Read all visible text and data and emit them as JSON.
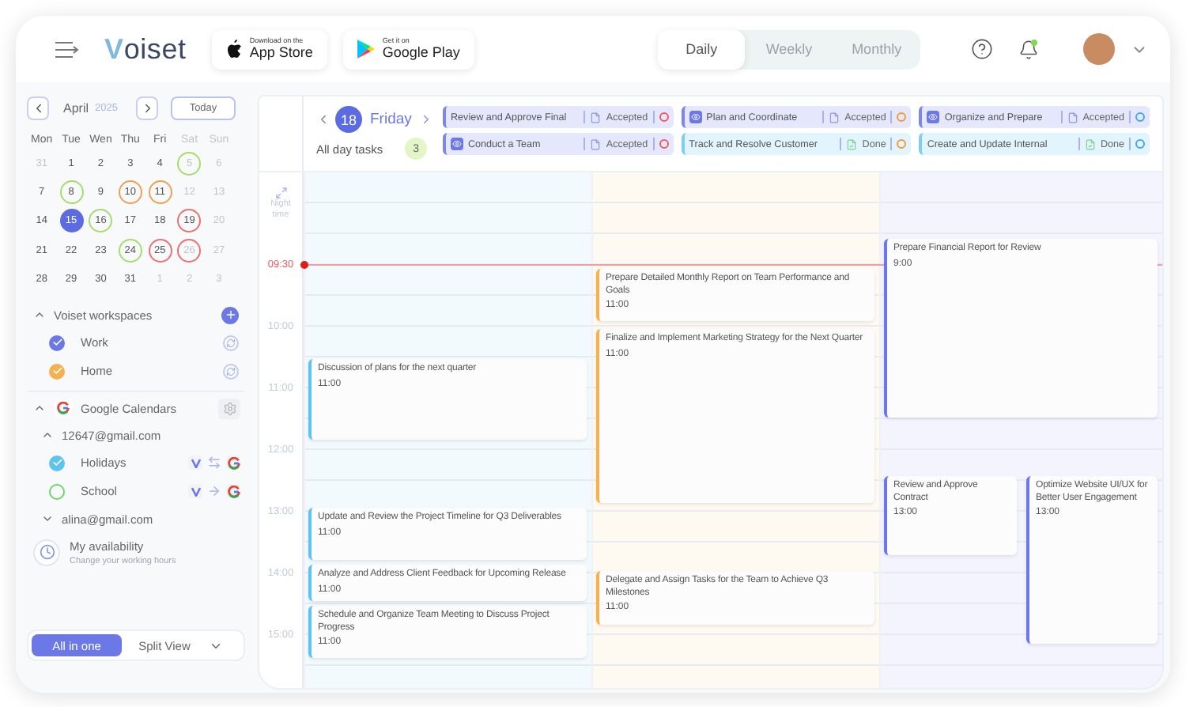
{
  "header": {
    "logo": "Voiset",
    "store_badges": [
      {
        "kind": "apple",
        "small": "Download on the",
        "big": "App Store"
      },
      {
        "kind": "google",
        "small": "Get it on",
        "big": "Google Play"
      }
    ],
    "views": [
      {
        "label": "Daily",
        "selected": true
      },
      {
        "label": "Weekly",
        "selected": false
      },
      {
        "label": "Monthly",
        "selected": false
      }
    ],
    "notifications_unread": true
  },
  "mini_calendar": {
    "month": "April",
    "year": "2025",
    "today": "Today",
    "weekdays": [
      {
        "label": "Mon",
        "weekend": false
      },
      {
        "label": "Tue",
        "weekend": false
      },
      {
        "label": "Wen",
        "weekend": false
      },
      {
        "label": "Thu",
        "weekend": false
      },
      {
        "label": "Fri",
        "weekend": false
      },
      {
        "label": "Sat",
        "weekend": true
      },
      {
        "label": "Sun",
        "weekend": true
      }
    ],
    "weeks": [
      [
        {
          "label": "31",
          "faded": true,
          "selected": false
        },
        {
          "label": "1",
          "faded": false,
          "selected": false
        },
        {
          "label": "2",
          "faded": false,
          "selected": false
        },
        {
          "label": "3",
          "faded": false,
          "selected": false
        },
        {
          "label": "4",
          "faded": false,
          "selected": false
        },
        {
          "label": "5",
          "faded": true,
          "selected": false,
          "color": "#a6dc6b"
        },
        {
          "label": "6",
          "faded": true,
          "selected": false
        }
      ],
      [
        {
          "label": "7",
          "faded": false,
          "selected": false
        },
        {
          "label": "8",
          "faded": false,
          "selected": false,
          "color": "#a6dc6b"
        },
        {
          "label": "9",
          "faded": false,
          "selected": false
        },
        {
          "label": "10",
          "faded": false,
          "selected": false,
          "color": "#f0a050"
        },
        {
          "label": "11",
          "faded": false,
          "selected": false,
          "color": "#f0a050"
        },
        {
          "label": "12",
          "faded": true,
          "selected": false
        },
        {
          "label": "13",
          "faded": true,
          "selected": false
        }
      ],
      [
        {
          "label": "14",
          "faded": false,
          "selected": false
        },
        {
          "label": "15",
          "faded": false,
          "selected": true
        },
        {
          "label": "16",
          "faded": false,
          "selected": false,
          "color": "#a6dc6b"
        },
        {
          "label": "17",
          "faded": false,
          "selected": false
        },
        {
          "label": "18",
          "faded": false,
          "selected": false
        },
        {
          "label": "19",
          "faded": false,
          "selected": false,
          "color": "#ec6f6f"
        },
        {
          "label": "20",
          "faded": true,
          "selected": false
        }
      ],
      [
        {
          "label": "21",
          "faded": false,
          "selected": false
        },
        {
          "label": "22",
          "faded": false,
          "selected": false
        },
        {
          "label": "23",
          "faded": false,
          "selected": false
        },
        {
          "label": "24",
          "faded": false,
          "selected": false,
          "color": "#a6dc6b"
        },
        {
          "label": "25",
          "faded": false,
          "selected": false,
          "color": "#ec6f6f"
        },
        {
          "label": "26",
          "faded": true,
          "selected": false,
          "color": "#ec6f6f"
        },
        {
          "label": "27",
          "faded": true,
          "selected": false
        }
      ],
      [
        {
          "label": "28",
          "faded": false,
          "selected": false
        },
        {
          "label": "29",
          "faded": false,
          "selected": false
        },
        {
          "label": "30",
          "faded": false,
          "selected": false
        },
        {
          "label": "31",
          "faded": false,
          "selected": false
        },
        {
          "label": "1",
          "faded": true,
          "selected": false
        },
        {
          "label": "2",
          "faded": true,
          "selected": false
        },
        {
          "label": "3",
          "faded": true,
          "selected": false
        }
      ]
    ]
  },
  "workspaces": {
    "title": "Voiset workspaces",
    "expanded": true,
    "items": [
      {
        "name": "Work",
        "checked": true,
        "color": "#6b78e5"
      },
      {
        "name": "Home",
        "checked": true,
        "color": "#f5b04f"
      }
    ]
  },
  "google": {
    "title": "Google Calendars",
    "expanded": true,
    "accounts": [
      {
        "email": "12647@gmail.com",
        "expanded": true,
        "calendars": [
          {
            "name": "Holidays",
            "checked": true,
            "color": "#5ec3ef",
            "two_way": true
          },
          {
            "name": "School",
            "checked": false,
            "color": "#6fd36b",
            "two_way": false
          }
        ]
      },
      {
        "email": "alina@gmail.com",
        "expanded": false
      }
    ]
  },
  "availability": {
    "title": "My availability",
    "subtitle": "Change your working hours"
  },
  "view_mode": [
    {
      "label": "All in one",
      "selected": true
    },
    {
      "label": "Split View",
      "selected": false
    }
  ],
  "day": {
    "number": "18",
    "name": "Friday",
    "all_day_label": "All day tasks",
    "all_day_count": "3"
  },
  "all_day_columns": [
    [
      {
        "title": "Review and Approve Final",
        "kind": "task",
        "status": "Accepted",
        "done": false,
        "color": "#ef5b5b"
      },
      {
        "title": "Conduct a Team",
        "kind": "meeting",
        "status": "Accepted",
        "done": false,
        "color": "#ef5b5b"
      }
    ],
    [
      {
        "title": "Plan and Coordinate",
        "kind": "meeting",
        "status": "Accepted",
        "done": false,
        "color": "#f59a2f"
      },
      {
        "title": "Track and Resolve Customer",
        "kind": "task",
        "status": "Done",
        "done": true,
        "color": "#f59a2f"
      }
    ],
    [
      {
        "title": "Organize and Prepare",
        "kind": "meeting",
        "status": "Accepted",
        "done": false,
        "color": "#3fa9f0"
      },
      {
        "title": "Create and Update Internal",
        "kind": "task",
        "status": "Done",
        "done": true,
        "color": "#3fa9f0"
      }
    ]
  ],
  "night_label": "Night time",
  "times": [
    {
      "label": "09:30",
      "kind": "now"
    },
    {
      "label": "10:00",
      "kind": "hour"
    },
    {
      "label": "11:00",
      "kind": "hour"
    },
    {
      "label": "12:00",
      "kind": "hour"
    },
    {
      "label": "13:00",
      "kind": "hour"
    },
    {
      "label": "14:00",
      "kind": "hour"
    },
    {
      "label": "15:00",
      "kind": "hour"
    }
  ],
  "columns": [
    {
      "color": "#5ec3ef",
      "events": [
        {
          "title": "Discussion of plans for the next quarter",
          "time": "11:00"
        },
        {
          "title": "Update and Review the Project Timeline for Q3 Deliverables",
          "time": "11:00"
        },
        {
          "title": "Analyze and Address Client Feedback for Upcoming Release",
          "time": "11:00"
        },
        {
          "title": "Schedule and Organize Team Meeting to Discuss Project Progress",
          "time": "11:00"
        }
      ]
    },
    {
      "color": "#f5b04f",
      "events": [
        {
          "title": "Prepare Detailed Monthly Report on Team Performance and Goals",
          "time": "11:00"
        },
        {
          "title": "Finalize and Implement Marketing Strategy for the Next Quarter",
          "time": "11:00"
        },
        {
          "title": "Delegate and Assign Tasks for the Team to Achieve Q3 Milestones",
          "time": "11:00"
        }
      ]
    },
    {
      "color": "#6b78e5",
      "events": [
        {
          "title": "Prepare Financial Report for Review",
          "time": "9:00"
        },
        {
          "title": "Review and Approve Contract",
          "time": "13:00"
        },
        {
          "title": "Optimize Website UI/UX for Better User Engagement",
          "time": "13:00"
        }
      ]
    }
  ]
}
